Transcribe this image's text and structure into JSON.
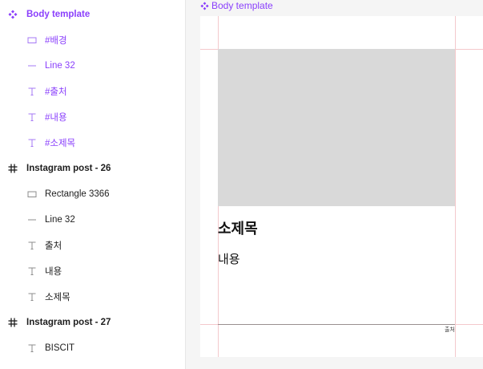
{
  "layers": [
    {
      "label": "Body template",
      "icon": "component-icon",
      "kind": "component",
      "color": "#8a3ffc",
      "bold": true
    },
    {
      "label": "#배경",
      "icon": "rectangle-icon",
      "kind": "child",
      "color": "#8a3ffc"
    },
    {
      "label": "Line 32",
      "icon": "line-icon",
      "kind": "child",
      "color": "#8a3ffc"
    },
    {
      "label": "#출처",
      "icon": "text-icon",
      "kind": "child",
      "color": "#8a3ffc"
    },
    {
      "label": "#내용",
      "icon": "text-icon",
      "kind": "child",
      "color": "#8a3ffc"
    },
    {
      "label": "#소제목",
      "icon": "text-icon",
      "kind": "child",
      "color": "#8a3ffc"
    },
    {
      "label": "Instagram post - 26",
      "icon": "frame-icon",
      "kind": "frame",
      "color": "#1e1e1e",
      "bold": true
    },
    {
      "label": "Rectangle 3366",
      "icon": "rectangle-icon",
      "kind": "child",
      "color": "#1e1e1e"
    },
    {
      "label": "Line 32",
      "icon": "line-icon",
      "kind": "child",
      "color": "#1e1e1e"
    },
    {
      "label": "출처",
      "icon": "text-icon",
      "kind": "child",
      "color": "#1e1e1e"
    },
    {
      "label": "내용",
      "icon": "text-icon",
      "kind": "child",
      "color": "#1e1e1e"
    },
    {
      "label": "소제목",
      "icon": "text-icon",
      "kind": "child",
      "color": "#1e1e1e"
    },
    {
      "label": "Instagram post - 27",
      "icon": "frame-icon",
      "kind": "frame",
      "color": "#1e1e1e",
      "bold": true
    },
    {
      "label": "BISCIT",
      "icon": "text-icon",
      "kind": "child",
      "color": "#1e1e1e"
    }
  ],
  "canvas": {
    "frame_title": "Body template",
    "subtitle": "소제목",
    "content": "내용",
    "source": "출처"
  },
  "colors": {
    "component": "#8a3ffc",
    "text": "#1e1e1e",
    "icon_gray": "#8c8c8c",
    "placeholder_fill": "#d9d9d9",
    "guide": "#f4c9cc"
  }
}
